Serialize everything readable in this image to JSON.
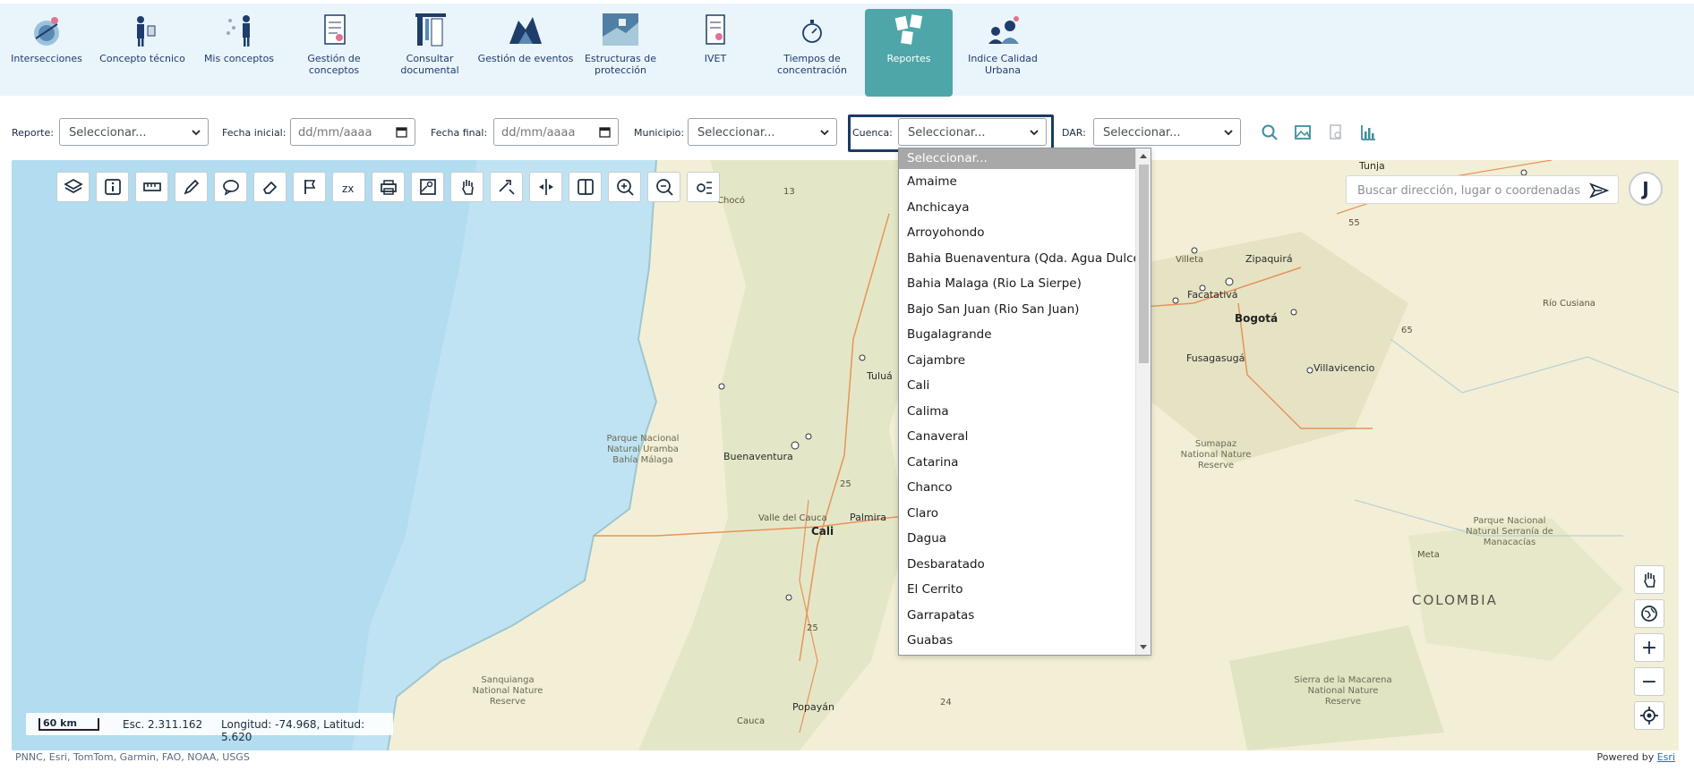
{
  "nav": {
    "items": [
      {
        "label": "Intersecciones",
        "icon": "intersections-icon"
      },
      {
        "label": "Concepto técnico",
        "icon": "technical-concept-icon"
      },
      {
        "label": "Mis conceptos",
        "icon": "my-concepts-icon"
      },
      {
        "label": "Gestión de conceptos",
        "icon": "concept-management-icon"
      },
      {
        "label": "Consultar documental",
        "icon": "documents-icon"
      },
      {
        "label": "Gestión de eventos",
        "icon": "events-icon"
      },
      {
        "label": "Estructuras de protección",
        "icon": "protection-structures-icon"
      },
      {
        "label": "IVET",
        "icon": "ivet-icon"
      },
      {
        "label": "Tiempos de concentración",
        "icon": "stopwatch-icon"
      },
      {
        "label": "Reportes",
        "icon": "reports-icon",
        "active": true
      },
      {
        "label": "Indice Calidad Urbana",
        "icon": "urban-quality-icon"
      }
    ],
    "accent": "#4ea6a8"
  },
  "filters": {
    "reporte": {
      "label": "Reporte:",
      "value": "Seleccionar..."
    },
    "fecha_inicial": {
      "label": "Fecha inicial:",
      "value": "dd/mm/aaaa"
    },
    "fecha_final": {
      "label": "Fecha final:",
      "value": "dd/mm/aaaa"
    },
    "municipio": {
      "label": "Municipio:",
      "value": "Seleccionar..."
    },
    "cuenca": {
      "label": "Cuenca:",
      "value": "Seleccionar..."
    },
    "dar": {
      "label": "DAR:",
      "value": "Seleccionar..."
    }
  },
  "dropdown": {
    "options": [
      "Seleccionar...",
      "Amaime",
      "Anchicaya",
      "Arroyohondo",
      "Bahia Buenaventura (Qda. Agua Dulce)",
      "Bahia Malaga (Rio La Sierpe)",
      "Bajo San Juan (Rio San Juan)",
      "Bugalagrande",
      "Cajambre",
      "Cali",
      "Calima",
      "Canaveral",
      "Catarina",
      "Chanco",
      "Claro",
      "Dagua",
      "Desbaratado",
      "El Cerrito",
      "Garrapatas",
      "Guabas"
    ]
  },
  "map": {
    "search_placeholder": "Buscar dirección, lugar o coordenadas",
    "user_initial": "J",
    "labels": {
      "tunja": "Tunja",
      "zipaquira": "Zipaquirá",
      "facatativa": "Facatativá",
      "bogota": "Bogotá",
      "fusagasuga": "Fusagasugá",
      "villavicencio": "Villavicencio",
      "tulua": "Tuluá",
      "buenaventura": "Buenaventura",
      "palmira": "Palmira",
      "cali": "Cali",
      "valle_del_cauca": "Valle del Cauca",
      "popayan": "Popayán",
      "cauca": "Cauca",
      "meta": "Meta",
      "colombia": "COLOMBIA",
      "villeta": "Villeta",
      "choco": "Chocó",
      "rio_cusiana": "Río Cusiana",
      "park_uramba": "Parque Nacional Natural Uramba Bahía Málaga",
      "park_sumapaz": "Sumapaz National Nature Reserve",
      "park_manacacias": "Parque Nacional Natural Serranía de Manacacías",
      "park_sanquianga": "Sanquianga National Nature Reserve",
      "park_macarena": "Sierra de la Macarena National Nature Reserve",
      "road_13": "13",
      "road_55": "55",
      "road_25a": "25",
      "road_25b": "25",
      "road_24": "24",
      "road_65": "65"
    },
    "scale": {
      "distance": "60 km",
      "esc": "Esc. 2.311.162",
      "coords": "Longitud: -74.968, Latitud: 5.620"
    },
    "attribution": "PNNC, Esri, TomTom, Garmin, FAO, NOAA, USGS",
    "powered_by": "Powered by",
    "esri": "Esri",
    "toolbar_icons": [
      "layers-icon",
      "info-icon",
      "ruler-icon",
      "pencil-icon",
      "comment-icon",
      "eraser-icon",
      "flag-icon",
      "coordinates-icon",
      "print-icon",
      "map-export-icon",
      "pan-hand-icon",
      "magic-tool-icon",
      "swipe-icon",
      "split-view-icon",
      "zoom-in-icon",
      "zoom-out-icon",
      "settings-filter-icon"
    ],
    "right_controls": {
      "zoom_in": "+",
      "zoom_out": "−"
    }
  }
}
